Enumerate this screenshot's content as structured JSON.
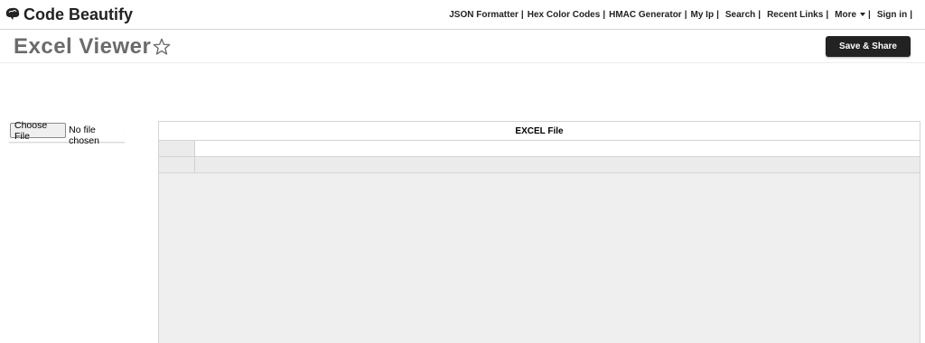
{
  "brand": {
    "name": "Code Beautify",
    "icon": "brain-icon"
  },
  "nav": {
    "links": [
      "JSON Formatter",
      "Hex Color Codes",
      "HMAC Generator",
      "My Ip",
      "Search",
      "Recent Links",
      "More",
      "Sign in"
    ],
    "separator": "|"
  },
  "page": {
    "title": "Excel Viewer",
    "favorite_icon": "star-outline-icon",
    "save_label": "Save & Share"
  },
  "file_input": {
    "button_label": "Choose File",
    "status": "No file chosen"
  },
  "sheet": {
    "header": "EXCEL File"
  },
  "colors": {
    "title_gray": "#6b6b6b",
    "button_dark": "#222222",
    "grid_gray": "#efefef"
  }
}
